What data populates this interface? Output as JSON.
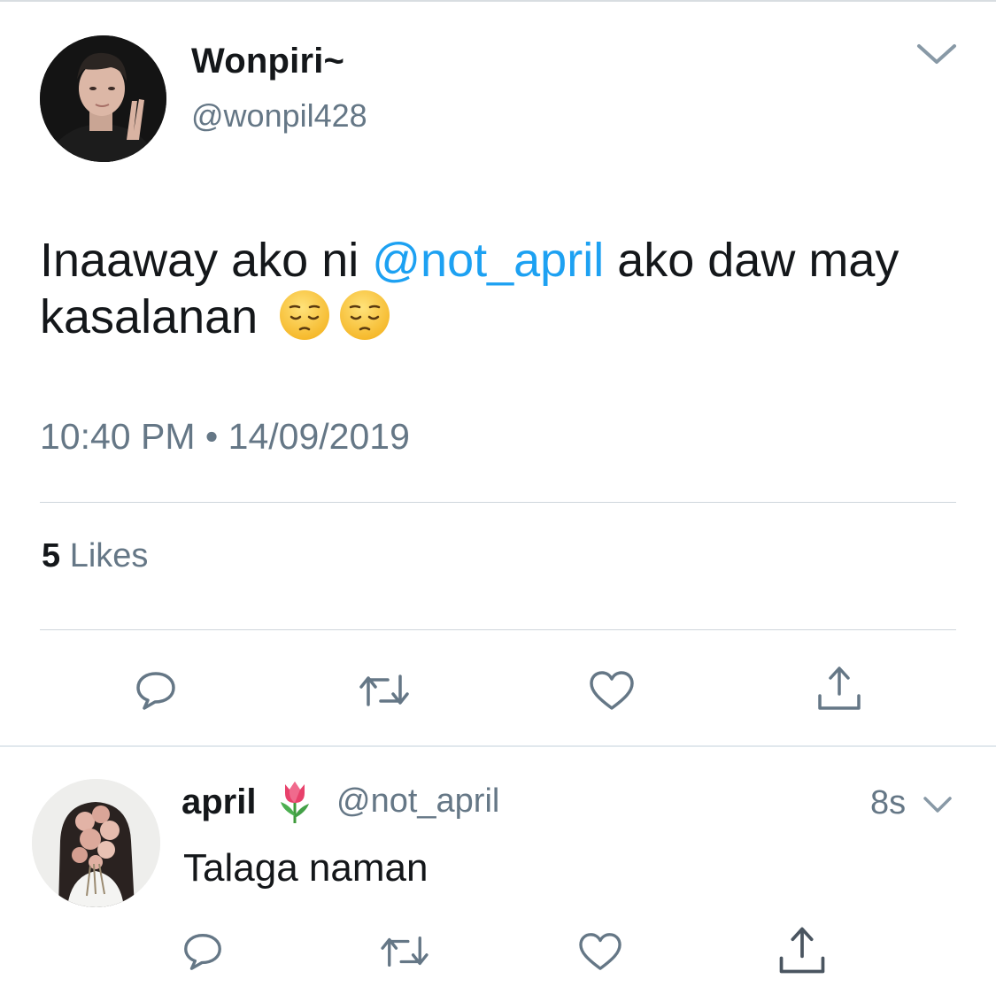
{
  "tweet": {
    "display_name": "Wonpiri~",
    "handle": "@wonpil428",
    "text_before": "Inaaway ako ni ",
    "mention": "@not_april",
    "text_after": " ako daw may kasalanan ",
    "emoji": [
      "pensive-face",
      "pensive-face"
    ],
    "time": "10:40 PM",
    "separator": "•",
    "date": "14/09/2019",
    "likes_count": "5",
    "likes_label": "Likes"
  },
  "reply": {
    "display_name": "april",
    "badge_emoji": "tulip",
    "handle": "@not_april",
    "time": "8s",
    "text": "Talaga naman"
  },
  "actions": [
    "reply-icon",
    "retweet-icon",
    "like-icon",
    "share-icon"
  ],
  "colors": {
    "text": "#14171a",
    "secondary": "#657786",
    "link": "#1da1f2",
    "divider": "#cfd6dc"
  }
}
